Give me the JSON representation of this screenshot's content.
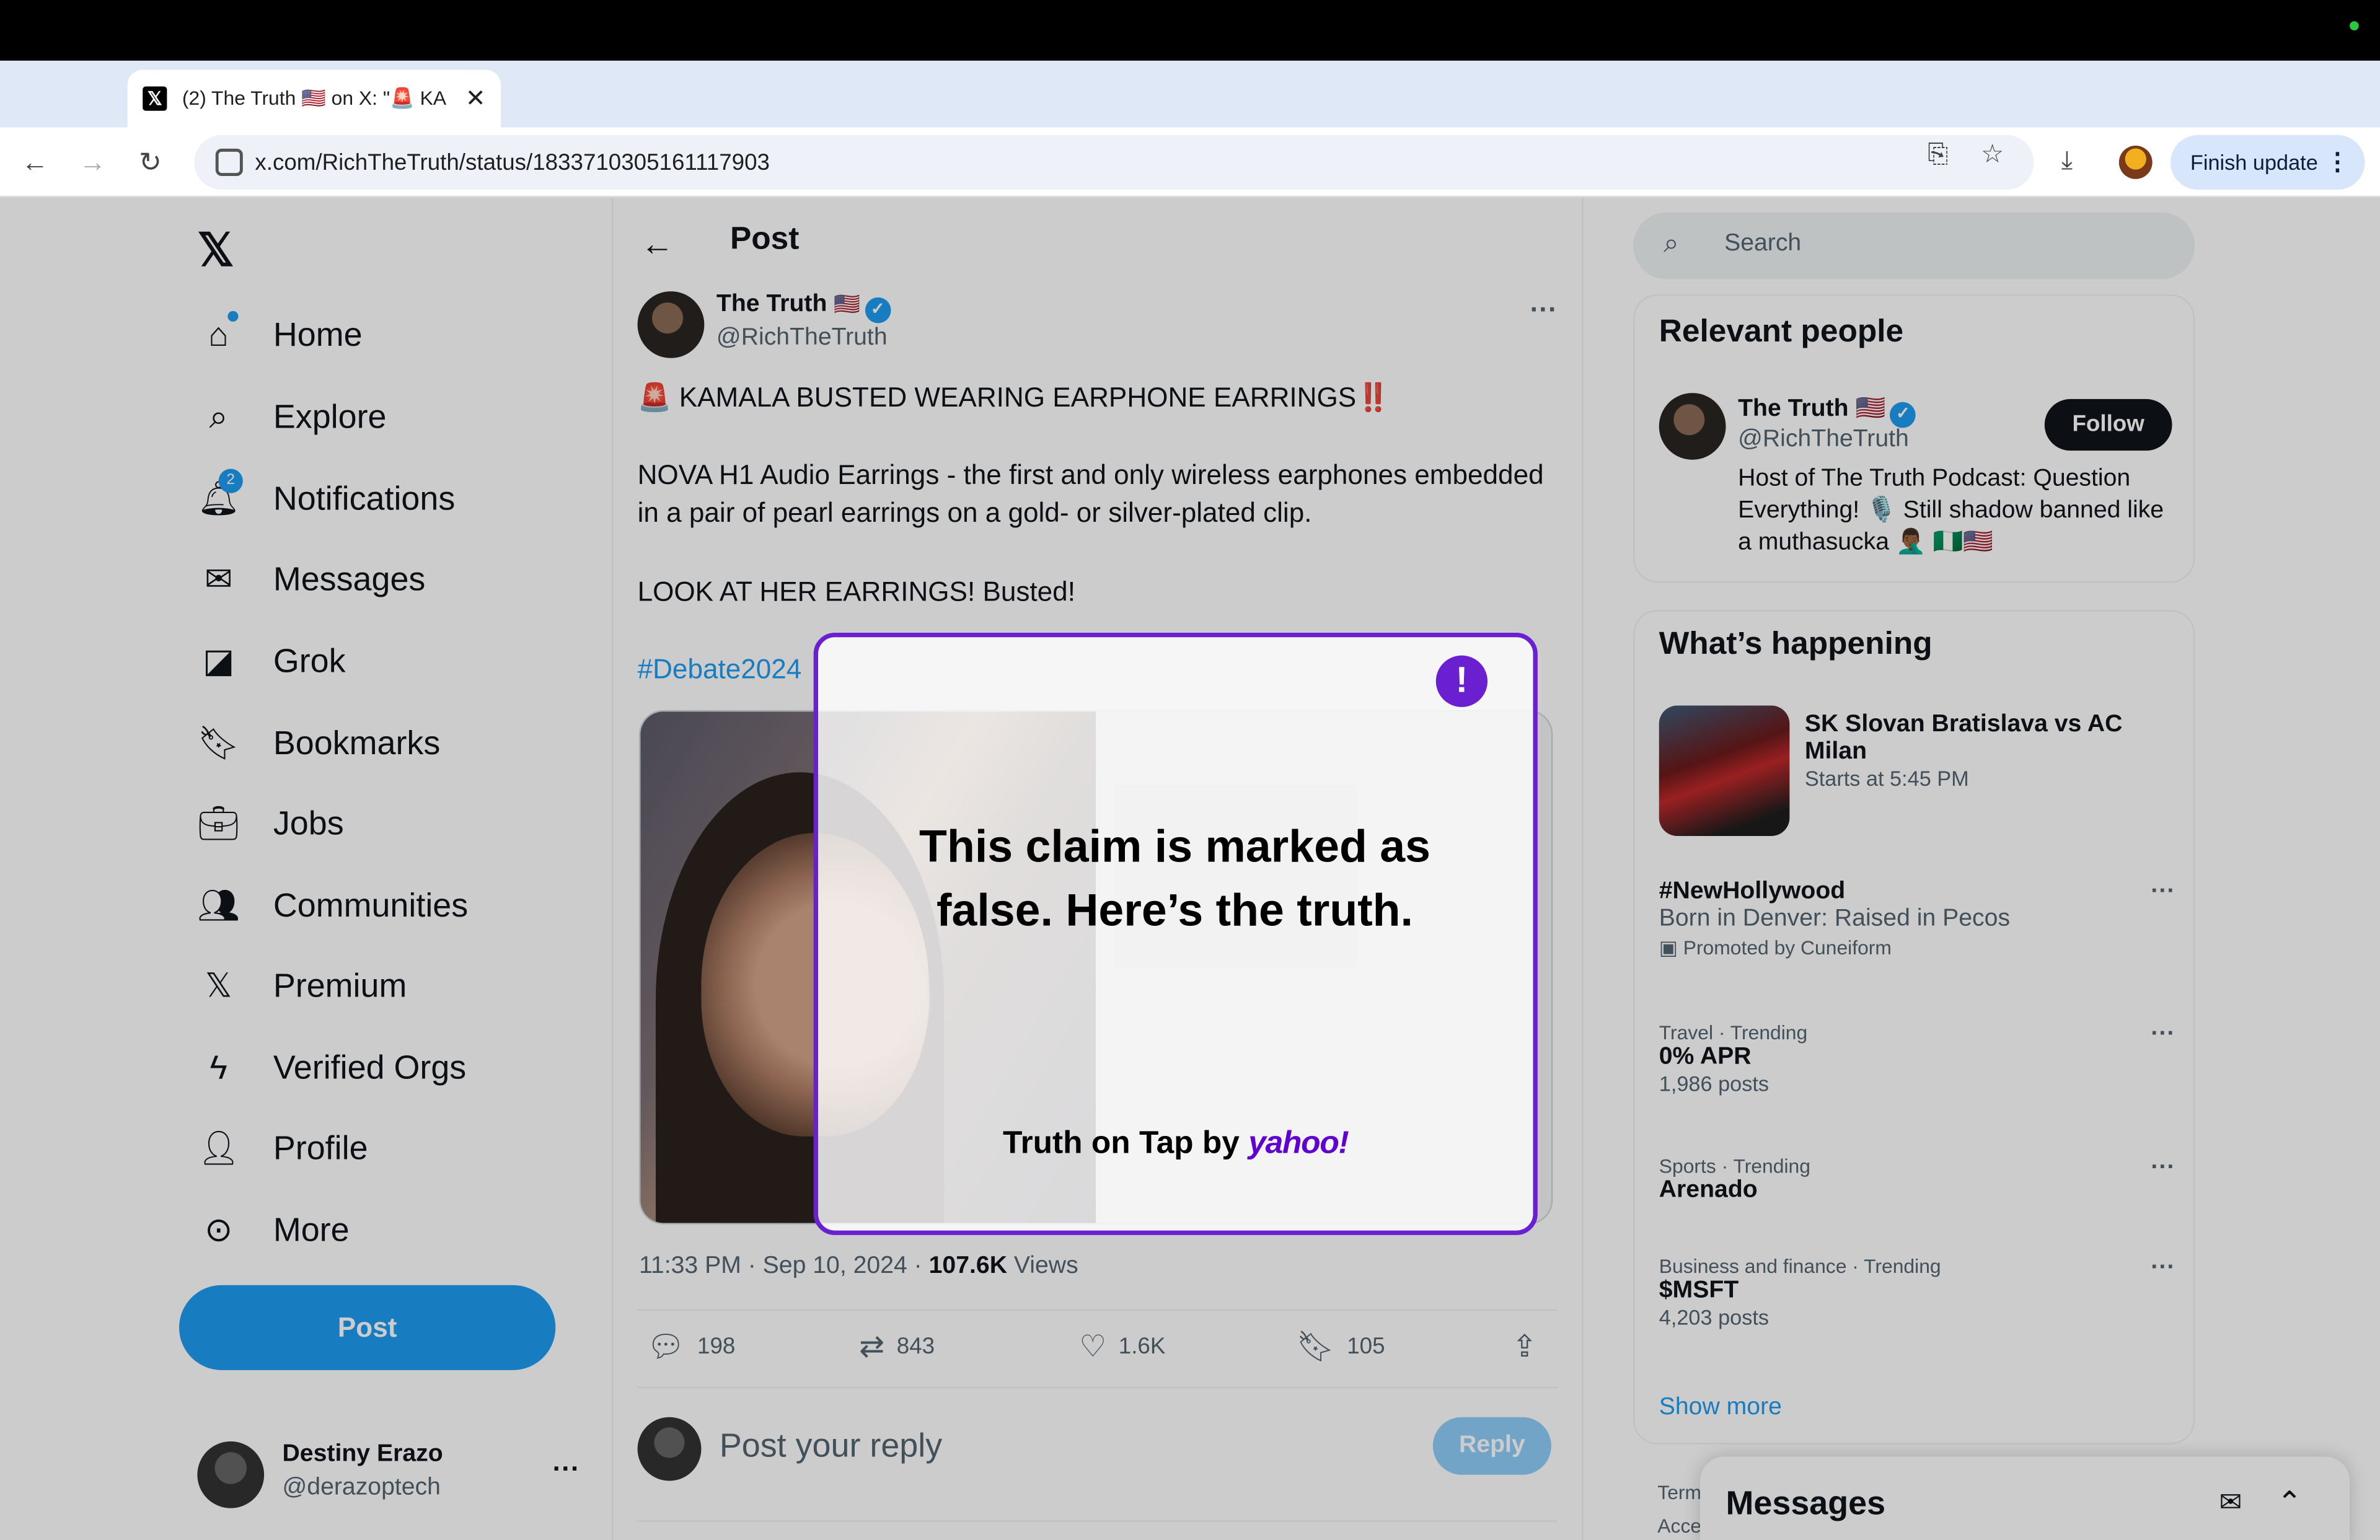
{
  "browser": {
    "tab_title": "(2) The Truth 🇺🇸 on X: \"🚨 KA",
    "url_host": "x.com",
    "url_path": "/RichTheTruth/status/1833710305161117903",
    "finish_update": "Finish update"
  },
  "nav": {
    "items": [
      {
        "label": "Home",
        "icon": "home-icon"
      },
      {
        "label": "Explore",
        "icon": "search-icon"
      },
      {
        "label": "Notifications",
        "icon": "bell-icon",
        "badge": "2"
      },
      {
        "label": "Messages",
        "icon": "mail-icon"
      },
      {
        "label": "Grok",
        "icon": "grok-icon"
      },
      {
        "label": "Bookmarks",
        "icon": "bookmark-icon"
      },
      {
        "label": "Jobs",
        "icon": "briefcase-icon"
      },
      {
        "label": "Communities",
        "icon": "people-icon"
      },
      {
        "label": "Premium",
        "icon": "x-icon"
      },
      {
        "label": "Verified Orgs",
        "icon": "lightning-icon"
      },
      {
        "label": "Profile",
        "icon": "person-icon"
      },
      {
        "label": "More",
        "icon": "more-circle-icon"
      }
    ],
    "post_button": "Post",
    "account": {
      "name": "Destiny Erazo",
      "handle": "@derazoptech"
    }
  },
  "post": {
    "header": "Post",
    "author_name": "The Truth",
    "author_flag": "🇺🇸",
    "author_handle": "@RichTheTruth",
    "line1": "🚨 KAMALA BUSTED WEARING EARPHONE EARRINGS‼️",
    "line2": "NOVA H1 Audio Earrings - the first and only wireless earphones embedded in a pair of pearl earrings on a gold- or silver-plated clip.",
    "line3": "LOOK AT HER EARRINGS! Busted!",
    "hashtag": "#Debate2024",
    "time": "11:33 PM · Sep 10, 2024 · ",
    "views_count": "107.6K",
    "views_label": " Views",
    "replies": "198",
    "reposts": "843",
    "likes": "1.6K",
    "bookmarks": "105",
    "reply_placeholder": "Post your reply",
    "reply_button": "Reply"
  },
  "sidebar": {
    "search_placeholder": "Search",
    "relevant_title": "Relevant people",
    "person_name": "The Truth",
    "person_flag": "🇺🇸",
    "person_handle": "@RichTheTruth",
    "person_bio": "Host of The Truth Podcast: Question Everything! 🎙️ Still shadow banned like a muthasucka 🤦🏾‍♂️ 🇳🇬🇺🇸",
    "follow": "Follow",
    "happening_title": "What’s happening",
    "trends": [
      {
        "category": "",
        "title": "SK Slovan Bratislava vs AC Milan",
        "sub": "Starts at 5:45 PM"
      },
      {
        "category": "",
        "title": "#NewHollywood",
        "sub": "Born in Denver: Raised in Pecos",
        "promo": "Promoted by Cuneiform"
      },
      {
        "category": "Travel · Trending",
        "title": "0% APR",
        "sub": "1,986 posts"
      },
      {
        "category": "Sports · Trending",
        "title": "Arenado",
        "sub": ""
      },
      {
        "category": "Business and finance · Trending",
        "title": "$MSFT",
        "sub": "4,203 posts"
      }
    ],
    "show_more": "Show more",
    "footer1": "Term",
    "footer2": "Acce",
    "messages": "Messages"
  },
  "modal": {
    "headline": "This claim is marked as false. Here’s the truth.",
    "brand_prefix": "Truth on Tap by ",
    "brand_name": "yahoo!",
    "accent": "#6a1fd0"
  }
}
